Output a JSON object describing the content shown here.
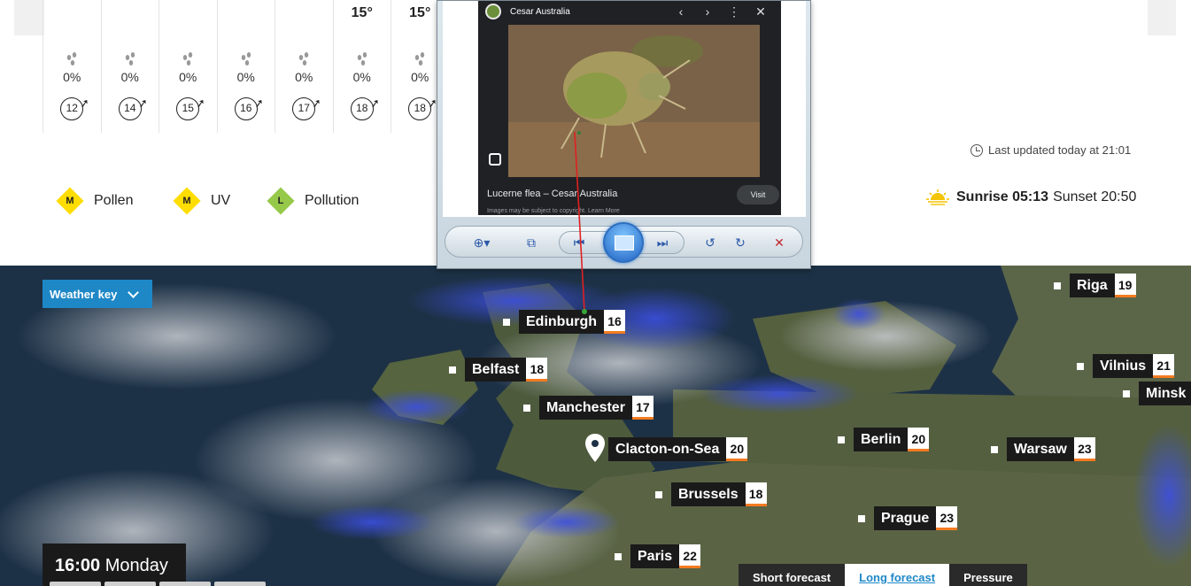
{
  "forecast": {
    "hours": [
      {
        "temp": "",
        "precip": "0%",
        "wind": "12"
      },
      {
        "temp": "",
        "precip": "0%",
        "wind": "14"
      },
      {
        "temp": "",
        "precip": "0%",
        "wind": "15"
      },
      {
        "temp": "",
        "precip": "0%",
        "wind": "16"
      },
      {
        "temp": "",
        "precip": "0%",
        "wind": "17"
      },
      {
        "temp": "15°",
        "precip": "0%",
        "wind": "18"
      },
      {
        "temp": "15°",
        "precip": "0%",
        "wind": "18"
      }
    ],
    "last_updated": "Last updated today at 21:01",
    "env": {
      "pollen": {
        "level": "M",
        "label": "Pollen",
        "color": "#ffdd00"
      },
      "uv": {
        "level": "M",
        "label": "UV",
        "color": "#ffdd00"
      },
      "pollution": {
        "level": "L",
        "label": "Pollution",
        "color": "#96c84a"
      }
    },
    "sun": {
      "sunrise_label": "Sunrise 05:13",
      "sunset_label": "Sunset 20:50"
    }
  },
  "map": {
    "weather_key_label": "Weather key",
    "cities": [
      {
        "name": "Edinburgh",
        "temp": "16"
      },
      {
        "name": "Belfast",
        "temp": "18"
      },
      {
        "name": "Manchester",
        "temp": "17"
      },
      {
        "name": "Clacton-on-Sea",
        "temp": "20"
      },
      {
        "name": "Brussels",
        "temp": "18"
      },
      {
        "name": "Paris",
        "temp": "22"
      },
      {
        "name": "Berlin",
        "temp": "20"
      },
      {
        "name": "Prague",
        "temp": "23"
      },
      {
        "name": "Warsaw",
        "temp": "23"
      },
      {
        "name": "Vilnius",
        "temp": "21"
      },
      {
        "name": "Riga",
        "temp": "19"
      },
      {
        "name": "Minsk",
        "temp": ""
      }
    ],
    "time": "16:00",
    "day": "Monday",
    "tabs": {
      "short": "Short forecast",
      "long": "Long forecast",
      "pressure": "Pressure"
    },
    "accent_color": "#f47b20"
  },
  "viewer": {
    "site": "Cesar Australia",
    "caption": "Lucerne flea – Cesar Australia",
    "visit": "Visit",
    "notice": "Images may be subject to copyright. Learn More"
  }
}
